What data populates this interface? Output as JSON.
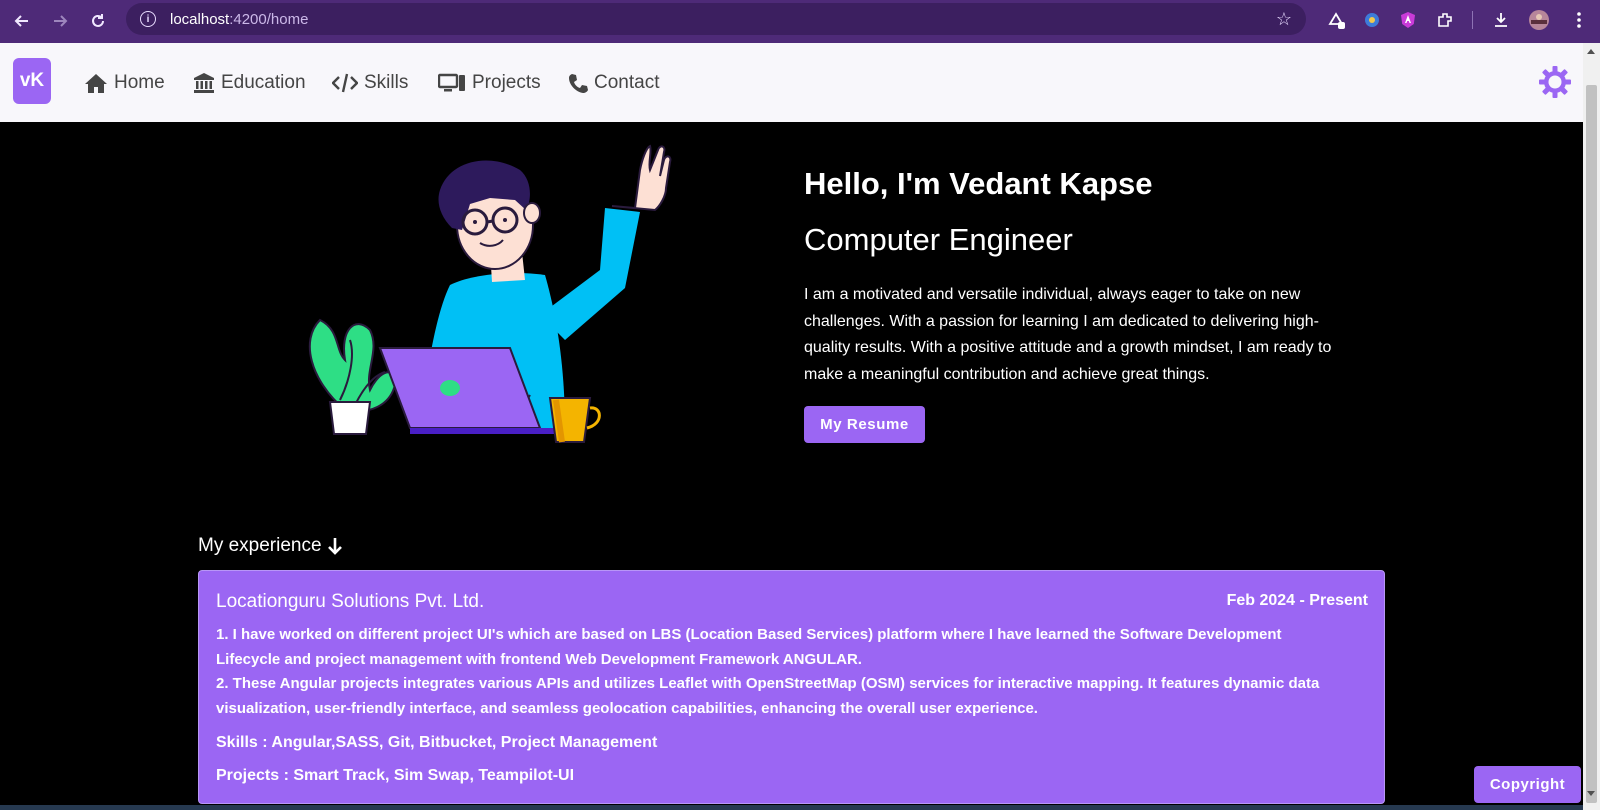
{
  "browser": {
    "url_host": "localhost",
    "url_path": ":4200/home"
  },
  "nav": {
    "logo": "vK",
    "items": [
      {
        "label": "Home",
        "icon": "home-icon"
      },
      {
        "label": "Education",
        "icon": "bank-icon"
      },
      {
        "label": "Skills",
        "icon": "code-icon"
      },
      {
        "label": "Projects",
        "icon": "desktop-icon"
      },
      {
        "label": "Contact",
        "icon": "phone-icon"
      }
    ],
    "theme_icon": "gear-icon"
  },
  "hero": {
    "title": "Hello, I'm Vedant Kapse",
    "role": "Computer Engineer",
    "description": "I am a motivated and versatile individual, always eager to take on new challenges. With a passion for learning I am dedicated to delivering high-quality results. With a positive attitude and a growth mindset, I am ready to make a meaningful contribution and achieve great things.",
    "resume_button": "My Resume"
  },
  "experience": {
    "heading": "My experience",
    "company": "Locationguru Solutions Pvt. Ltd.",
    "date": "Feb 2024 - Present",
    "points": [
      "1. I have worked on different project UI's which are based on LBS (Location Based Services) platform where I have learned the Software Development Lifecycle and project management with frontend Web Development Framework ANGULAR.",
      "2. These Angular projects integrates various APIs and utilizes Leaflet with OpenStreetMap (OSM) services for interactive mapping. It features dynamic data visualization, user-friendly interface, and seamless geolocation capabilities, enhancing the overall user experience."
    ],
    "skills": "Skills : Angular,SASS, Git, Bitbucket, Project Management",
    "projects": "Projects : Smart Track, Sim Swap, Teampilot-UI"
  },
  "footer": {
    "copyright": "Copyright"
  },
  "colors": {
    "accent": "#9b66f3",
    "chrome": "#4e2a78",
    "background": "#000000"
  }
}
